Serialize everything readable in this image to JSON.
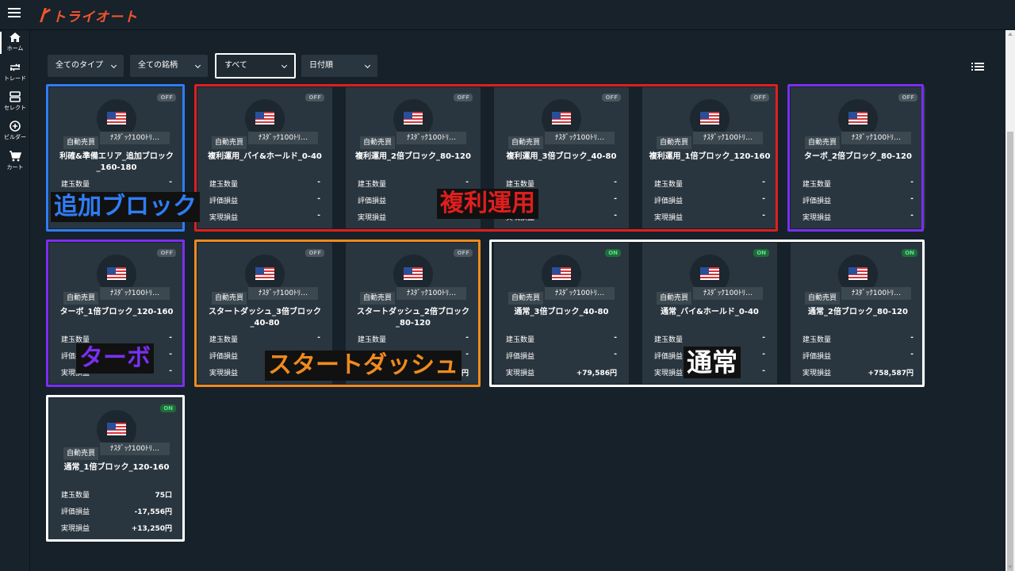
{
  "header": {
    "logo_text": "トライオート",
    "brand_color": "#f2552c"
  },
  "sidebar": {
    "items": [
      {
        "label": "ホーム",
        "icon": "home-icon"
      },
      {
        "label": "トレード",
        "icon": "trade-icon"
      },
      {
        "label": "セレクト",
        "icon": "select-icon"
      },
      {
        "label": "ビルダー",
        "icon": "builder-icon"
      },
      {
        "label": "カート",
        "icon": "cart-icon"
      }
    ]
  },
  "filters": {
    "type": "全てのタイプ",
    "symbol": "全ての銘柄",
    "status": "すべて",
    "sort": "日付順"
  },
  "labels": {
    "auto_trade": "自動売買",
    "symbol_tag": "ﾅｽﾀﾞｯｸ100ﾄﾘ…",
    "qty": "建玉数量",
    "unrealized": "評価損益",
    "realized": "実現損益"
  },
  "cards": [
    {
      "name": "利確&準備エリア_追加ブロック_160-180",
      "status": "OFF",
      "qty": "-",
      "unrealized": "-",
      "realized": "-"
    },
    {
      "name": "複利運用_バイ&ホールド_0-40",
      "status": "OFF",
      "qty": "-",
      "unrealized": "-",
      "realized": "-"
    },
    {
      "name": "複利運用_2倍ブロック_80-120",
      "status": "OFF",
      "qty": "-",
      "unrealized": "-",
      "realized": "-"
    },
    {
      "name": "複利運用_3倍ブロック_40-80",
      "status": "OFF",
      "qty": "-",
      "unrealized": "-",
      "realized": "-"
    },
    {
      "name": "複利運用_1倍ブロック_120-160",
      "status": "OFF",
      "qty": "-",
      "unrealized": "-",
      "realized": "-"
    },
    {
      "name": "ターボ_2倍ブロック_80-120",
      "status": "OFF",
      "qty": "-",
      "unrealized": "-",
      "realized": "-"
    },
    {
      "name": "ターボ_1倍ブロック_120-160",
      "status": "OFF",
      "qty": "-",
      "unrealized": "-",
      "realized": "-"
    },
    {
      "name": "スタートダッシュ_3倍ブロック_40-80",
      "status": "OFF",
      "qty": "-",
      "unrealized": "-",
      "realized": "-"
    },
    {
      "name": "スタートダッシュ_2倍ブロック_80-120",
      "status": "OFF",
      "qty": "-",
      "unrealized": "-",
      "realized": "+741,659円"
    },
    {
      "name": "通常_3倍ブロック_40-80",
      "status": "ON",
      "qty": "-",
      "unrealized": "-",
      "realized": "+79,586円"
    },
    {
      "name": "通常_バイ&ホールド_0-40",
      "status": "ON",
      "qty": "-",
      "unrealized": "-",
      "realized": "-"
    },
    {
      "name": "通常_2倍ブロック_80-120",
      "status": "ON",
      "qty": "-",
      "unrealized": "-",
      "realized": "+758,587円"
    },
    {
      "name": "通常_1倍ブロック_120-160",
      "status": "ON",
      "qty": "75口",
      "unrealized": "-17,556円",
      "realized": "+13,250円"
    }
  ],
  "annotations": [
    {
      "text": "追加ブロック",
      "color": "#2f7df6"
    },
    {
      "text": "複利運用",
      "color": "#e01e1e"
    },
    {
      "text": "ターボ",
      "color": "#7a2ff0"
    },
    {
      "text": "スタートダッシュ",
      "color": "#f08a1e"
    },
    {
      "text": "通常",
      "color": "#ffffff"
    }
  ]
}
